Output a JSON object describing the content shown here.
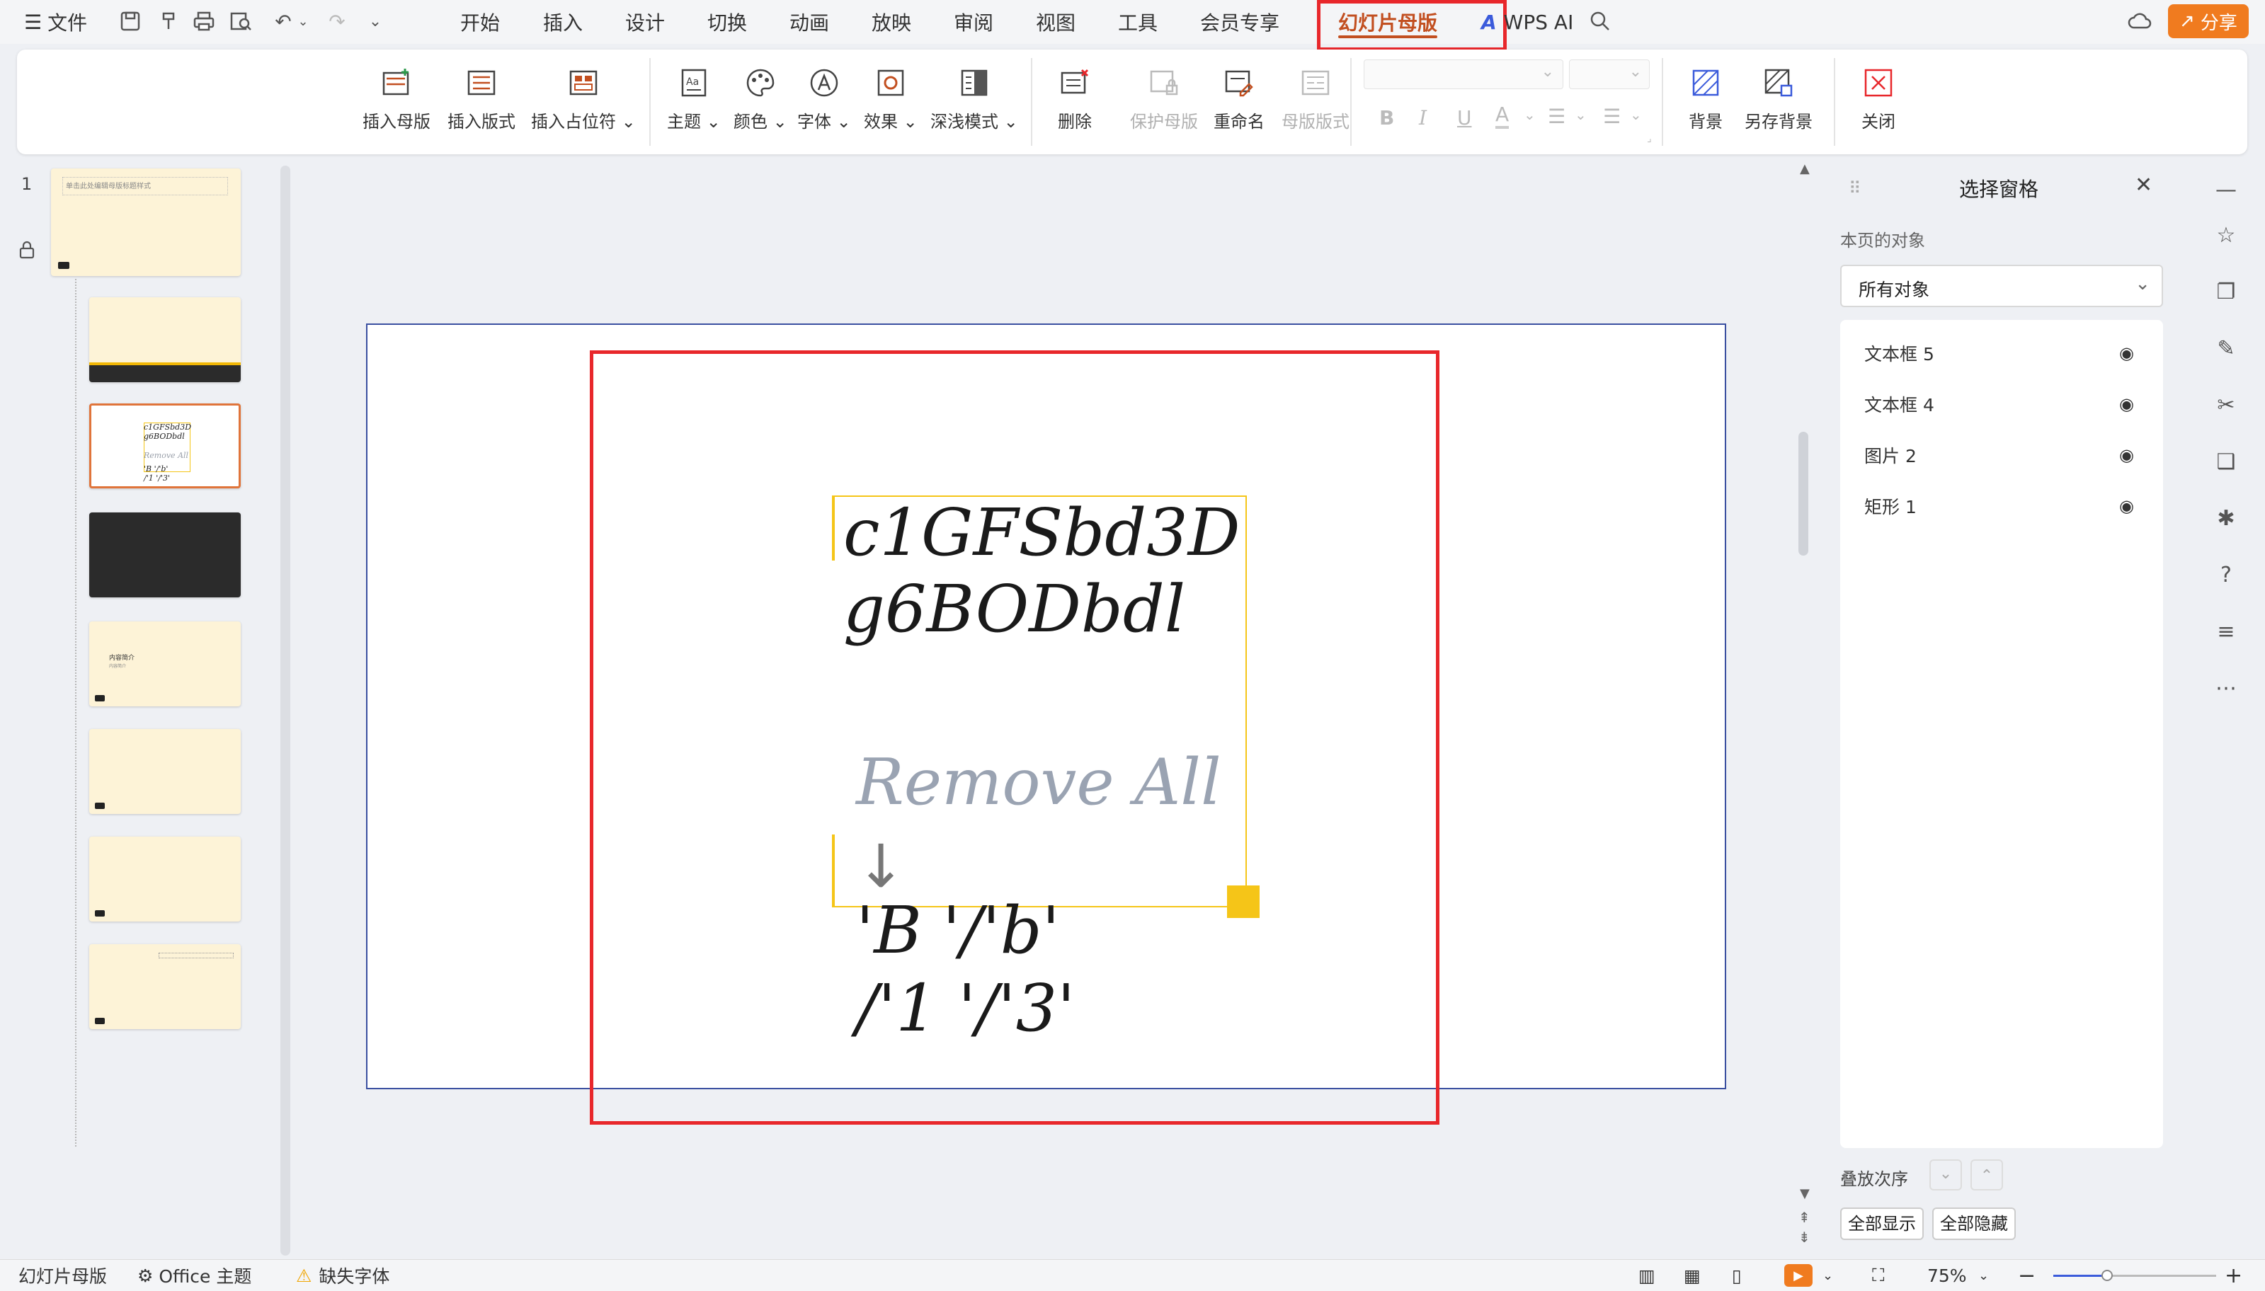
{
  "topbar": {
    "menu_label": "文件",
    "tabs": [
      "开始",
      "插入",
      "设计",
      "切换",
      "动画",
      "放映",
      "审阅",
      "视图",
      "工具",
      "会员专享",
      "幻灯片母版"
    ],
    "wps_ai": "WPS AI",
    "share_label": "分享"
  },
  "ribbon": {
    "buttons": [
      "插入母版",
      "插入版式",
      "插入占位符",
      "主题",
      "颜色",
      "字体",
      "效果",
      "深浅模式",
      "删除",
      "保护母版",
      "重命名",
      "母版版式",
      "背景",
      "另存背景",
      "关闭"
    ]
  },
  "thumbnails": {
    "slide_number": "1",
    "master_title": "单击此处编辑母版标题样式",
    "thumb3_text": [
      "c1GFSbd3D",
      "g6BODbdl",
      "Remove All",
      "'B '/'b'",
      "/'1 '/'3'"
    ],
    "thumb5_title": "内容简介",
    "thumb5_sub": "内容简介"
  },
  "slide": {
    "line1": "c1GFSbd3D",
    "line2": "g6BODbdl",
    "remove_text": "Remove All",
    "arrow": "↓",
    "line3": "'B '/'b'",
    "line4": "/'1 '/'3'"
  },
  "pane": {
    "title": "选择窗格",
    "section_label": "本页的对象",
    "filter_value": "所有对象",
    "objects": [
      "文本框 5",
      "文本框 4",
      "图片 2",
      "矩形 1"
    ],
    "order_label": "叠放次序",
    "show_all": "全部显示",
    "hide_all": "全部隐藏"
  },
  "status": {
    "mode": "幻灯片母版",
    "theme": "Office 主题",
    "missing_font": "缺失字体",
    "zoom": "75%"
  },
  "colors": {
    "accent": "#c24f20",
    "highlight_red": "#e8272b",
    "thumb_bg": "#fdf3d7",
    "selection_yellow": "#f5c518"
  }
}
